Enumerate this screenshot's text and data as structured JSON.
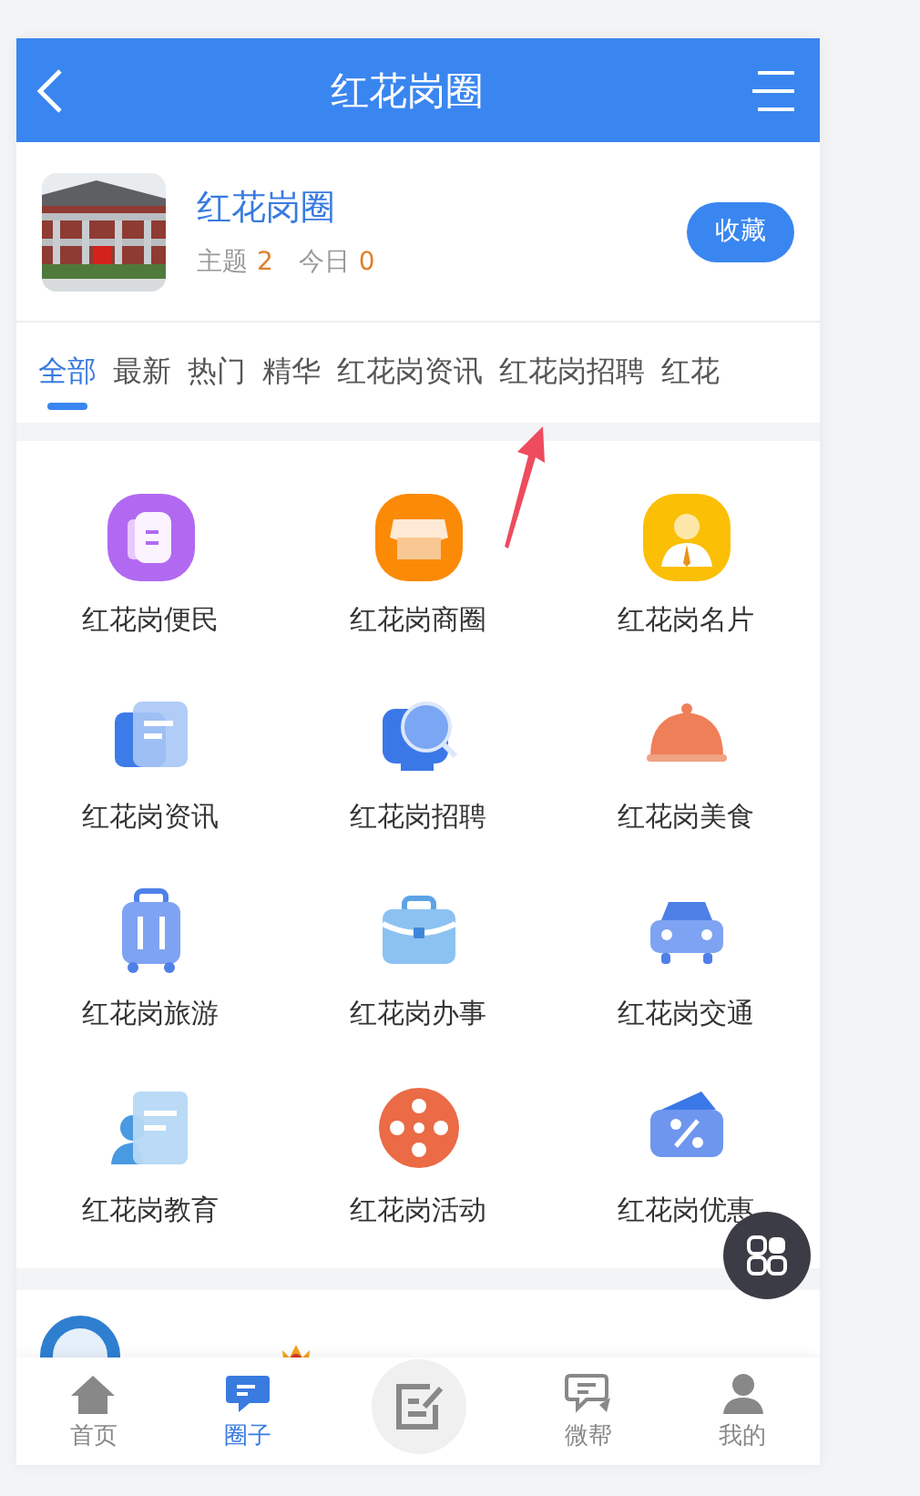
{
  "header": {
    "title": "红花岗圈"
  },
  "circle": {
    "name": "红花岗圈",
    "stats": [
      {
        "label": "主题",
        "value": "2"
      },
      {
        "label": "今日",
        "value": "0"
      }
    ],
    "button": "收藏"
  },
  "tabs": [
    {
      "label": "全部",
      "selected": true
    },
    {
      "label": "最新",
      "selected": false
    },
    {
      "label": "热门",
      "selected": false
    },
    {
      "label": "精华",
      "selected": false
    },
    {
      "label": "红花岗资讯",
      "selected": false
    },
    {
      "label": "红花岗招聘",
      "selected": false
    },
    {
      "label": "红花",
      "selected": false
    }
  ],
  "grid": [
    {
      "label": "红花岗便民"
    },
    {
      "label": "红花岗商圈"
    },
    {
      "label": "红花岗名片"
    },
    {
      "label": "红花岗资讯"
    },
    {
      "label": "红花岗招聘"
    },
    {
      "label": "红花岗美食"
    },
    {
      "label": "红花岗旅游"
    },
    {
      "label": "红花岗办事"
    },
    {
      "label": "红花岗交通"
    },
    {
      "label": "红花岗教育"
    },
    {
      "label": "红花岗活动"
    },
    {
      "label": "红花岗优惠"
    }
  ],
  "nav": [
    {
      "kind": "tab",
      "label": "首页",
      "selected": false
    },
    {
      "kind": "tab",
      "label": "圈子",
      "selected": true
    },
    {
      "kind": "compose",
      "selected": false
    },
    {
      "kind": "tab",
      "label": "微帮",
      "selected": false
    },
    {
      "kind": "tab",
      "label": "我的",
      "selected": false
    }
  ]
}
